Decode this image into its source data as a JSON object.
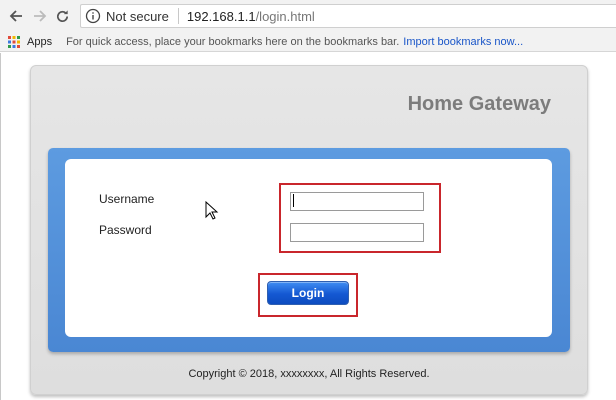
{
  "browser": {
    "security_text": "Not secure",
    "url_host": "192.168.1.1",
    "url_path": "/login.html",
    "icons": [
      "back-arrow-icon",
      "forward-arrow-icon",
      "reload-icon",
      "info-icon"
    ]
  },
  "bookmarks_bar": {
    "apps_label": "Apps",
    "hint_text": "For quick access, place your bookmarks here on the bookmarks bar.",
    "import_link": "Import bookmarks now..."
  },
  "page": {
    "title": "Home Gateway",
    "form": {
      "username_label": "Username",
      "password_label": "Password",
      "username_value": "",
      "password_value": "",
      "login_button": "Login"
    },
    "copyright": "Copyright © 2018, xxxxxxxx, All Rights Reserved."
  },
  "colors": {
    "accent_blue": "#4a87d3",
    "login_button": "#1458d2",
    "highlight_red": "#c9262c",
    "title_gray": "#7c7c7c"
  }
}
